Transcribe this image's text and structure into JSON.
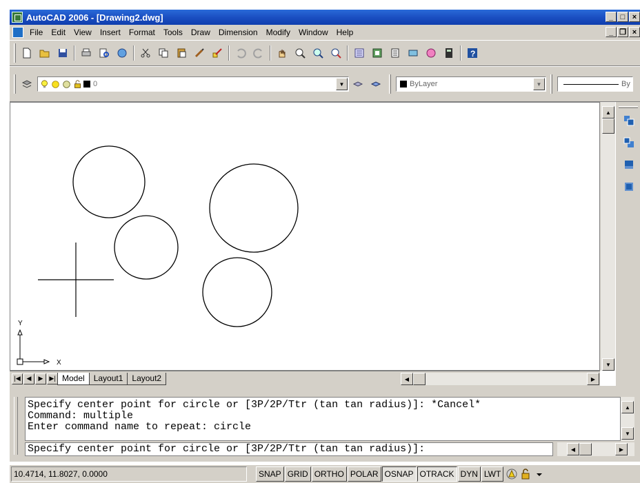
{
  "window": {
    "title": "AutoCAD 2006 - [Drawing2.dwg]",
    "buttons": [
      "_",
      "□",
      "×"
    ]
  },
  "menubar": {
    "items": [
      "File",
      "Edit",
      "View",
      "Insert",
      "Format",
      "Tools",
      "Draw",
      "Dimension",
      "Modify",
      "Window",
      "Help"
    ],
    "doc_buttons": [
      "_",
      "❐",
      "×"
    ]
  },
  "layer_toolbar": {
    "current_layer": "0",
    "color": "ByLayer",
    "linetype": "By"
  },
  "layout_tabs": {
    "tabs": [
      "Model",
      "Layout1",
      "Layout2"
    ],
    "active": "Model"
  },
  "ucs": {
    "y_label": "Y",
    "x_label": "X"
  },
  "command_window": {
    "history": [
      "Specify center point for circle or [3P/2P/Ttr (tan tan radius)]: *Cancel*",
      "Command: multiple",
      "Enter command name to repeat: circle"
    ],
    "prompt": "Specify center point for circle or [3P/2P/Ttr (tan tan radius)]:"
  },
  "statusbar": {
    "coordinates": "10.4714, 11.8027, 0.0000",
    "toggles": [
      {
        "label": "SNAP",
        "on": false
      },
      {
        "label": "GRID",
        "on": false
      },
      {
        "label": "ORTHO",
        "on": false
      },
      {
        "label": "POLAR",
        "on": false
      },
      {
        "label": "OSNAP",
        "on": true
      },
      {
        "label": "OTRACK",
        "on": true
      },
      {
        "label": "DYN",
        "on": false
      },
      {
        "label": "LWT",
        "on": false
      }
    ]
  }
}
